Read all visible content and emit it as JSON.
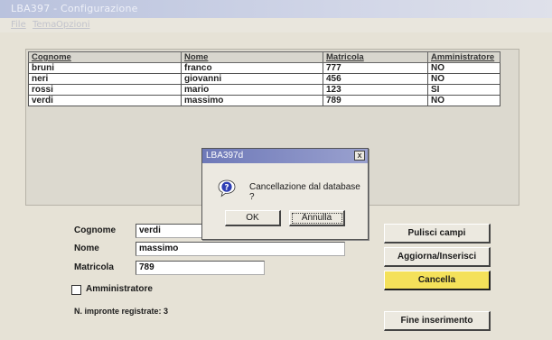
{
  "window": {
    "title": "LBA397 - Configurazione"
  },
  "menu": [
    "File",
    "Tema",
    "Opzioni"
  ],
  "grid": {
    "columns": [
      "Cognome",
      "Nome",
      "Matricola",
      "Amministratore"
    ],
    "rows": [
      [
        "bruni",
        "franco",
        "777",
        "NO"
      ],
      [
        "neri",
        "giovanni",
        "456",
        "NO"
      ],
      [
        "rossi",
        "mario",
        "123",
        "SI"
      ],
      [
        "verdi",
        "massimo",
        "789",
        "NO"
      ]
    ]
  },
  "form": {
    "cognome_label": "Cognome",
    "cognome_value": "verdi",
    "nome_label": "Nome",
    "nome_value": "massimo",
    "matricola_label": "Matricola",
    "matricola_value": "789",
    "amministratore_label": "Amministratore",
    "impronte_label": "N. impronte registrate:",
    "impronte_count": "3"
  },
  "buttons": {
    "pulisci": "Pulisci campi",
    "aggiorna": "Aggiorna/Inserisci",
    "cancella": "Cancella",
    "fine": "Fine inserimento"
  },
  "dialog": {
    "title": "LBA397d",
    "close": "x",
    "message": "Cancellazione dal database ?",
    "ok": "OK",
    "cancel": "Annulla"
  },
  "colors": {
    "accent_button": "#f4e15a",
    "dialog_title": "#6e79b8",
    "window_title": "#b9c2dd"
  }
}
